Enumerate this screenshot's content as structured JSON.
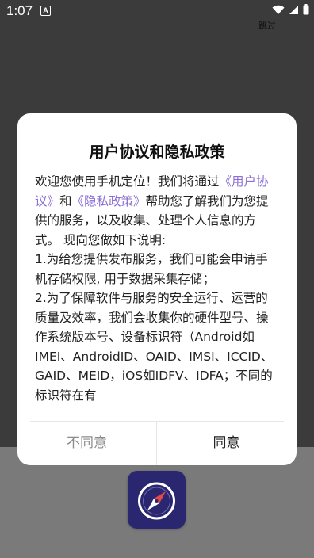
{
  "status_bar": {
    "time": "1:07",
    "indicator": "A",
    "icons": [
      "wifi-icon",
      "signal-icon",
      "battery-icon"
    ]
  },
  "skip": {
    "label": "跳过"
  },
  "dialog": {
    "title": "用户协议和隐私政策",
    "intro_before": "欢迎您使用手机定位！我们将通过",
    "link_user_agreement": "《用户协议》",
    "and": "和",
    "link_privacy_policy": "《隐私政策》",
    "intro_after": "帮助您了解我们为您提供的服务，以及收集、处理个人信息的方式。 现向您做如下说明:",
    "item1": "1.为给您提供发布服务，我们可能会申请手机存储权限, 用于数据采集存储；",
    "item2": "2.为了保障软件与服务的安全运行、运营的质量及效率，我们会收集你的硬件型号、操作系统版本号、设备标识符（Android如IMEI、AndroidID、OAID、IMSI、ICCID、GAID、MEID，iOS如IDFV、IDFA；不同的标识符在有",
    "disagree_label": "不同意",
    "agree_label": "同意"
  },
  "colors": {
    "link": "#8b6fd6",
    "overlay_top": "#3b3b3b",
    "overlay_bottom": "#7a7a7a",
    "app_icon_bg": "#2a2670"
  }
}
